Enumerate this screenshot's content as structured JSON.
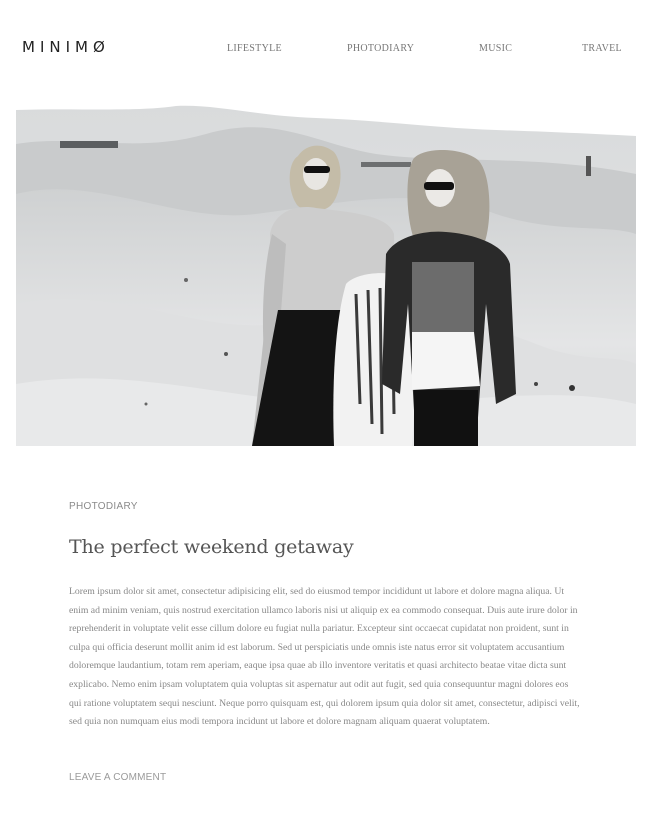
{
  "site": {
    "logo": "MINIMØ"
  },
  "nav": {
    "items": [
      {
        "label": "LIFESTYLE"
      },
      {
        "label": "PHOTODIARY"
      },
      {
        "label": "MUSIC"
      },
      {
        "label": "TRAVEL"
      }
    ]
  },
  "hero": {
    "alt": "Two women with sunglasses standing in a snowy, sandy landscape, black and white"
  },
  "post": {
    "category": "PHOTODIARY",
    "title": "The perfect weekend getaway",
    "body": "Lorem ipsum dolor sit amet, consectetur adipisicing elit, sed do eiusmod tempor incididunt ut labore et dolore magna aliqua. Ut enim ad minim veniam, quis nostrud exercitation ullamco laboris nisi ut aliquip ex ea commodo consequat. Duis aute irure dolor in reprehenderit in voluptate velit esse cillum dolore eu fugiat nulla pariatur. Excepteur sint occaecat cupidatat non proident, sunt in culpa qui officia deserunt mollit anim id est laborum. Sed ut perspiciatis unde omnis iste natus error sit voluptatem accusantium doloremque laudantium, totam rem aperiam, eaque ipsa quae ab illo inventore veritatis et quasi architecto beatae vitae dicta sunt explicabo. Nemo enim ipsam voluptatem quia voluptas sit aspernatur aut odit aut fugit, sed quia consequuntur magni dolores eos qui ratione voluptatem sequi nesciunt. Neque porro quisquam est, qui dolorem ipsum quia dolor sit amet, consectetur, adipisci velit, sed quia non numquam eius modi tempora incidunt ut labore et dolore magnam aliquam quaerat voluptatem.",
    "comment_link": "LEAVE A COMMENT"
  },
  "colors": {
    "text": "#555555",
    "muted": "#888888",
    "background": "#ffffff"
  }
}
